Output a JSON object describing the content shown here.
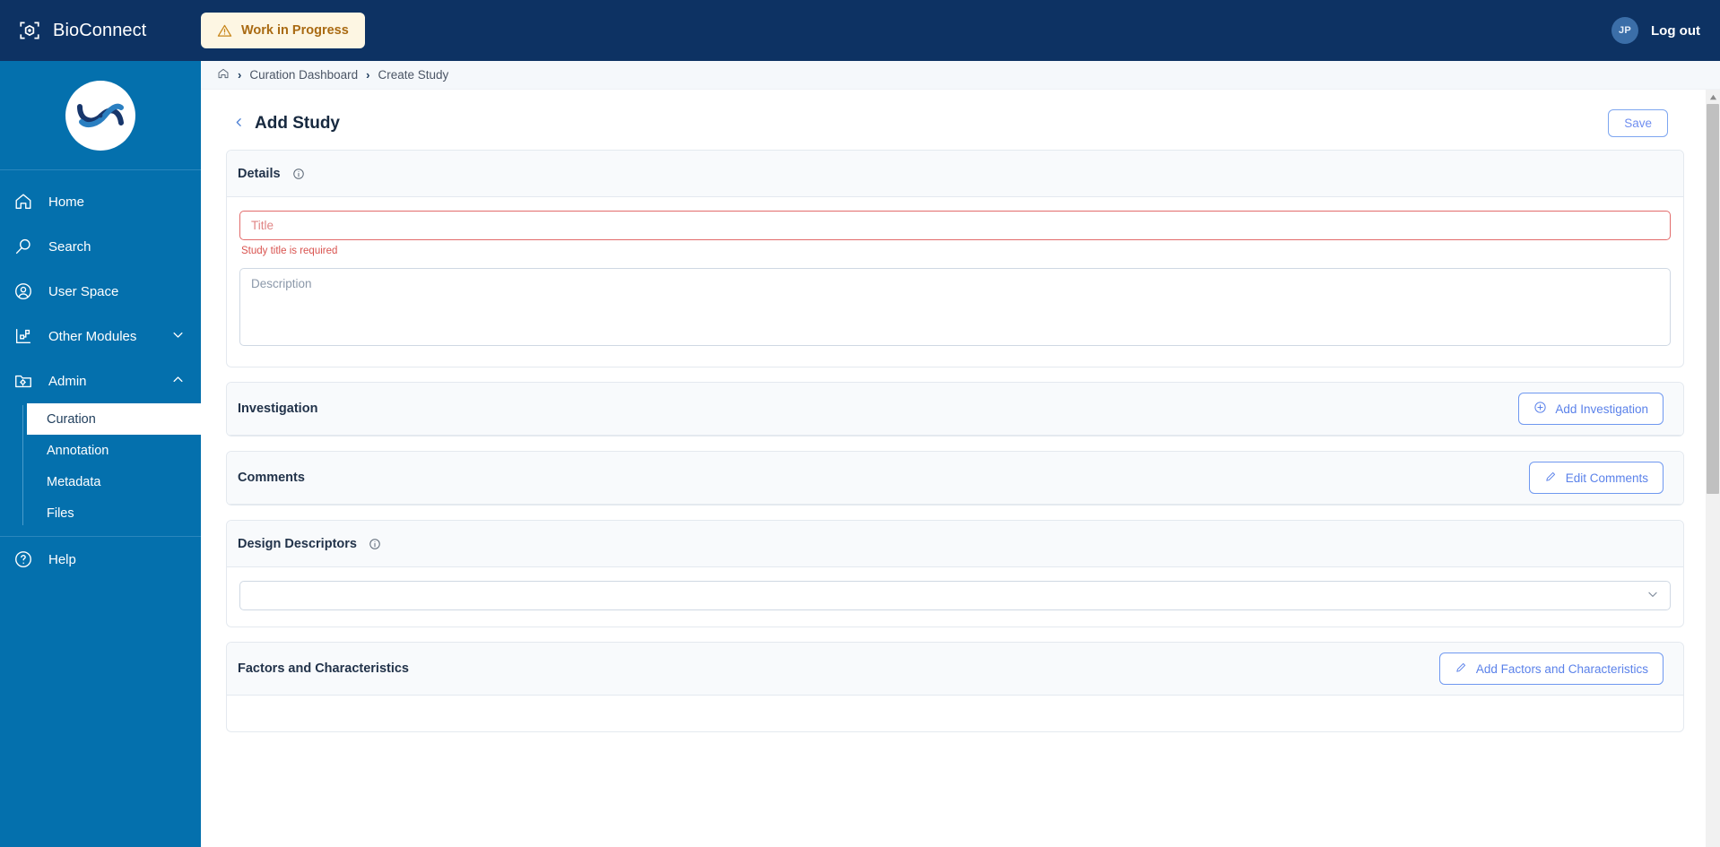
{
  "topbar": {
    "brand": "BioConnect",
    "brand_icon": "cube-scan-icon",
    "wip_label": "Work in Progress",
    "wip_icon": "warning-triangle-icon",
    "wip_bg": "#fdf6e3",
    "wip_text_color": "#a96a12",
    "avatar_initials": "JP",
    "logout_label": "Log out",
    "bg_color": "#0d3263"
  },
  "sidebar": {
    "bg_color": "#0470ad",
    "logo_alt": "JAX",
    "items": [
      {
        "label": "Home",
        "icon": "home-icon"
      },
      {
        "label": "Search",
        "icon": "search-icon"
      },
      {
        "label": "User Space",
        "icon": "user-circle-icon"
      },
      {
        "label": "Other Modules",
        "icon": "modules-icon",
        "chevron": "chevron-down-icon"
      },
      {
        "label": "Admin",
        "icon": "folder-gear-icon",
        "chevron": "chevron-up-icon"
      }
    ],
    "admin_children": [
      {
        "label": "Curation",
        "active": true
      },
      {
        "label": "Annotation",
        "active": false
      },
      {
        "label": "Metadata",
        "active": false
      },
      {
        "label": "Files",
        "active": false
      }
    ],
    "help": {
      "label": "Help",
      "icon": "question-circle-icon"
    }
  },
  "breadcrumb": {
    "home_icon": "home-outline-icon",
    "separator": "›",
    "items": [
      "Curation Dashboard",
      "Create Study"
    ]
  },
  "page": {
    "back_icon": "chevron-left-icon",
    "title": "Add Study",
    "save_label": "Save"
  },
  "sections": {
    "details": {
      "title": "Details",
      "info_icon": "info-circle-icon",
      "title_field": {
        "placeholder": "Title",
        "value": "",
        "error": "Study title is required",
        "error_color": "#d9534f"
      },
      "description_field": {
        "placeholder": "Description",
        "value": ""
      }
    },
    "investigation": {
      "title": "Investigation",
      "button_label": "Add Investigation",
      "button_icon": "plus-circle-icon"
    },
    "comments": {
      "title": "Comments",
      "button_label": "Edit Comments",
      "button_icon": "pencil-icon"
    },
    "design_descriptors": {
      "title": "Design Descriptors",
      "info_icon": "info-circle-icon",
      "select": {
        "value": "",
        "chevron_icon": "chevron-down-icon"
      }
    },
    "factors": {
      "title": "Factors and Characteristics",
      "button_label": "Add Factors and Characteristics",
      "button_icon": "pencil-icon"
    }
  },
  "scrollbar": {
    "up_arrow_icon": "caret-up-icon"
  }
}
